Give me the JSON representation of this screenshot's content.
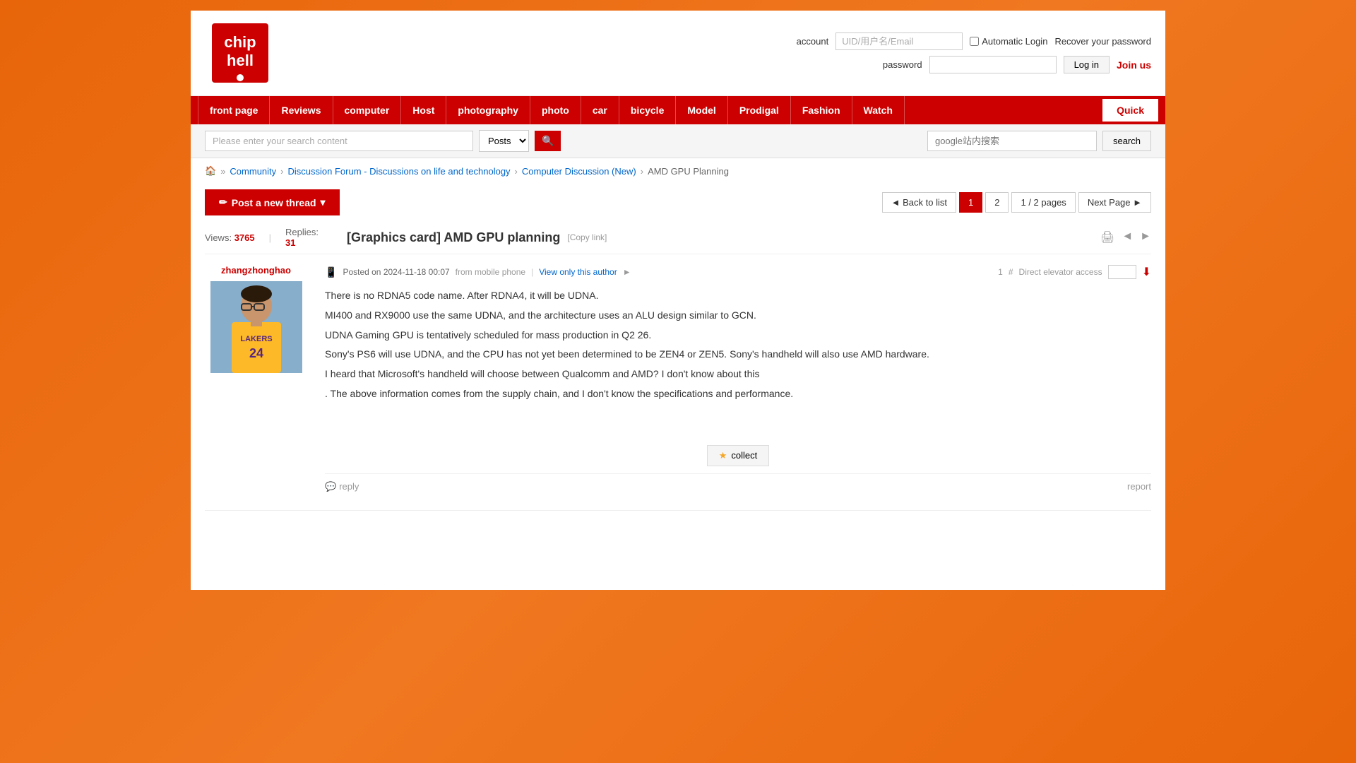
{
  "header": {
    "logo_text": "chip hell",
    "account_label": "account",
    "password_label": "password",
    "uid_placeholder": "UID/用户名/Email",
    "auto_login_label": "Automatic Login",
    "login_btn": "Log in",
    "recover_link": "Recover your password",
    "join_link": "Join us"
  },
  "navbar": {
    "items": [
      {
        "label": "front page"
      },
      {
        "label": "Reviews"
      },
      {
        "label": "computer"
      },
      {
        "label": "Host"
      },
      {
        "label": "photography"
      },
      {
        "label": "photo"
      },
      {
        "label": "car"
      },
      {
        "label": "bicycle"
      },
      {
        "label": "Model"
      },
      {
        "label": "Prodigal"
      },
      {
        "label": "Fashion"
      },
      {
        "label": "Watch"
      }
    ],
    "quick_label": "Quick"
  },
  "search": {
    "placeholder": "Please enter your search content",
    "select_option": "Posts",
    "google_placeholder": "google站内搜索",
    "search_btn": "search"
  },
  "breadcrumb": {
    "home": "🏠",
    "items": [
      {
        "label": "Community"
      },
      {
        "label": "Discussion Forum - Discussions on life and technology"
      },
      {
        "label": "Computer Discussion (New)"
      },
      {
        "label": "AMD GPU Planning"
      }
    ]
  },
  "controls": {
    "post_btn": "Post a new thread",
    "back_btn": "◄ Back to list",
    "page1": "1",
    "page2": "2",
    "current_page": "1",
    "total_pages": "2 pages",
    "next_btn": "Next Page ►"
  },
  "thread": {
    "prefix": "[Graphics card]",
    "title": "AMD GPU planning",
    "copy_link": "[Copy link]",
    "views_label": "Views:",
    "views_count": "3765",
    "replies_label": "Replies:",
    "replies_count": "31"
  },
  "post": {
    "author": "zhangzhonghao",
    "mobile_icon": "📱",
    "date": "Posted on 2024-11-18 00:07",
    "source": "from mobile phone",
    "view_author": "View only this author",
    "post_number": "1",
    "hash": "#",
    "direct_elevator": "Direct elevator access",
    "body": [
      "There is no RDNA5 code name. After RDNA4, it will be UDNA.",
      "MI400 and RX9000 use the same UDNA, and the architecture uses an ALU design similar to GCN.",
      "UDNA Gaming GPU is tentatively scheduled for mass production in Q2 26.",
      "Sony's PS6 will use UDNA, and the CPU has not yet been determined to be ZEN4 or ZEN5. Sony's handheld will also use AMD hardware.",
      "I heard that Microsoft's handheld will choose between Qualcomm and AMD? I don't know about this",
      ". The above information comes from the supply chain, and I don't know the specifications and performance."
    ],
    "collect_star": "★",
    "collect_label": "collect",
    "reply_label": "reply",
    "report_label": "report"
  }
}
